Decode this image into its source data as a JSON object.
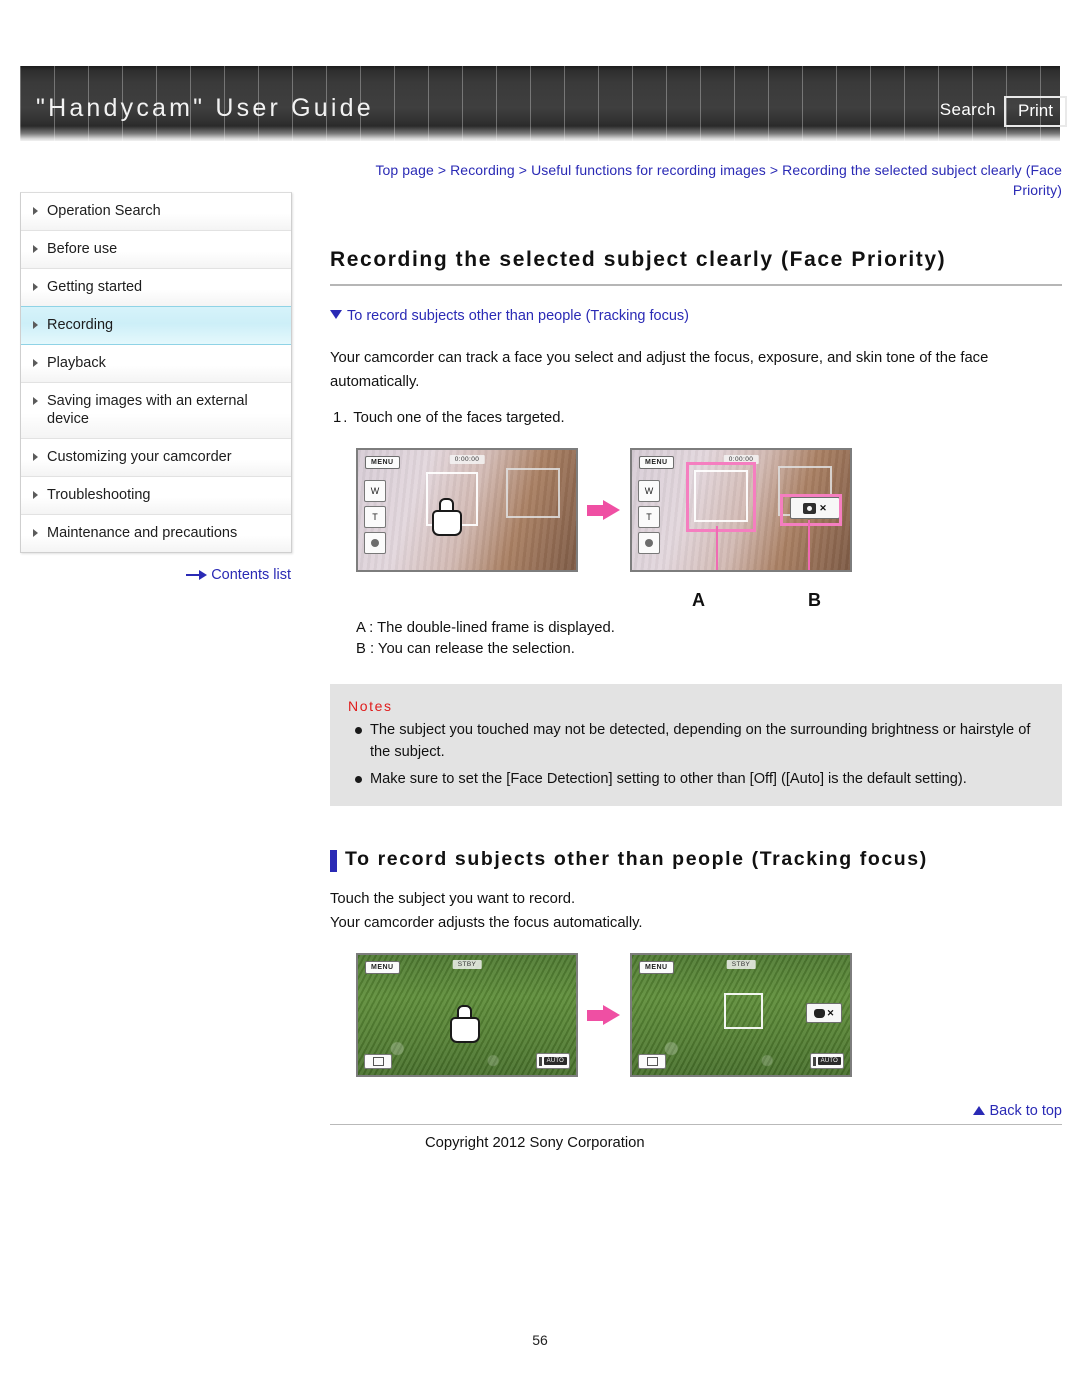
{
  "header": {
    "title": "\"Handycam\" User Guide",
    "search_label": "Search",
    "print_label": "Print"
  },
  "sidebar": {
    "items": [
      {
        "label": "Operation Search",
        "active": false
      },
      {
        "label": "Before use",
        "active": false
      },
      {
        "label": "Getting started",
        "active": false
      },
      {
        "label": "Recording",
        "active": true
      },
      {
        "label": "Playback",
        "active": false
      },
      {
        "label": "Saving images with an external device",
        "active": false
      },
      {
        "label": "Customizing your camcorder",
        "active": false
      },
      {
        "label": "Troubleshooting",
        "active": false
      },
      {
        "label": "Maintenance and precautions",
        "active": false
      }
    ],
    "contents_list_label": "Contents list"
  },
  "main": {
    "breadcrumb": "Top page > Recording > Useful functions for recording images > Recording the selected subject clearly (Face Priority)",
    "page_title": "Recording the selected subject clearly (Face Priority)",
    "jump_link": "To record subjects other than people (Tracking focus)",
    "intro_paragraph": "Your camcorder can track a face you select and adjust the focus, exposure, and skin tone of the face automatically.",
    "step_number": "1.",
    "step_text": "Touch one of the faces targeted.",
    "figure1": {
      "label_a": "A",
      "label_b": "B",
      "screen_left": {
        "menu_label": "MENU",
        "rec_label": "0:00:00",
        "wide_label": "W",
        "tele_label": "T"
      },
      "screen_right": {
        "menu_label": "MENU",
        "rec_label": "0:00:00",
        "wide_label": "W",
        "tele_label": "T"
      }
    },
    "captions": [
      "A : The double-lined frame is displayed.",
      "B : You can release the selection."
    ],
    "notes": {
      "title": "Notes",
      "items": [
        "The subject you touched may not be detected, depending on the surrounding brightness or hairstyle of the subject.",
        "Make sure to set the [Face Detection] setting to other than [Off] ([Auto] is the default setting)."
      ]
    },
    "section2": {
      "heading": "To record subjects other than people (Tracking focus)",
      "line1": "Touch the subject you want to record.",
      "line2": "Your camcorder adjusts the focus automatically.",
      "screen_left": {
        "menu_label": "MENU",
        "rec_label": "STBY",
        "auto_label": "AUTO"
      },
      "screen_right": {
        "menu_label": "MENU",
        "rec_label": "STBY",
        "auto_label": "AUTO"
      }
    }
  },
  "footer": {
    "back_to_top": "Back to top",
    "copyright": "Copyright 2012 Sony Corporation",
    "page_number": "56"
  }
}
